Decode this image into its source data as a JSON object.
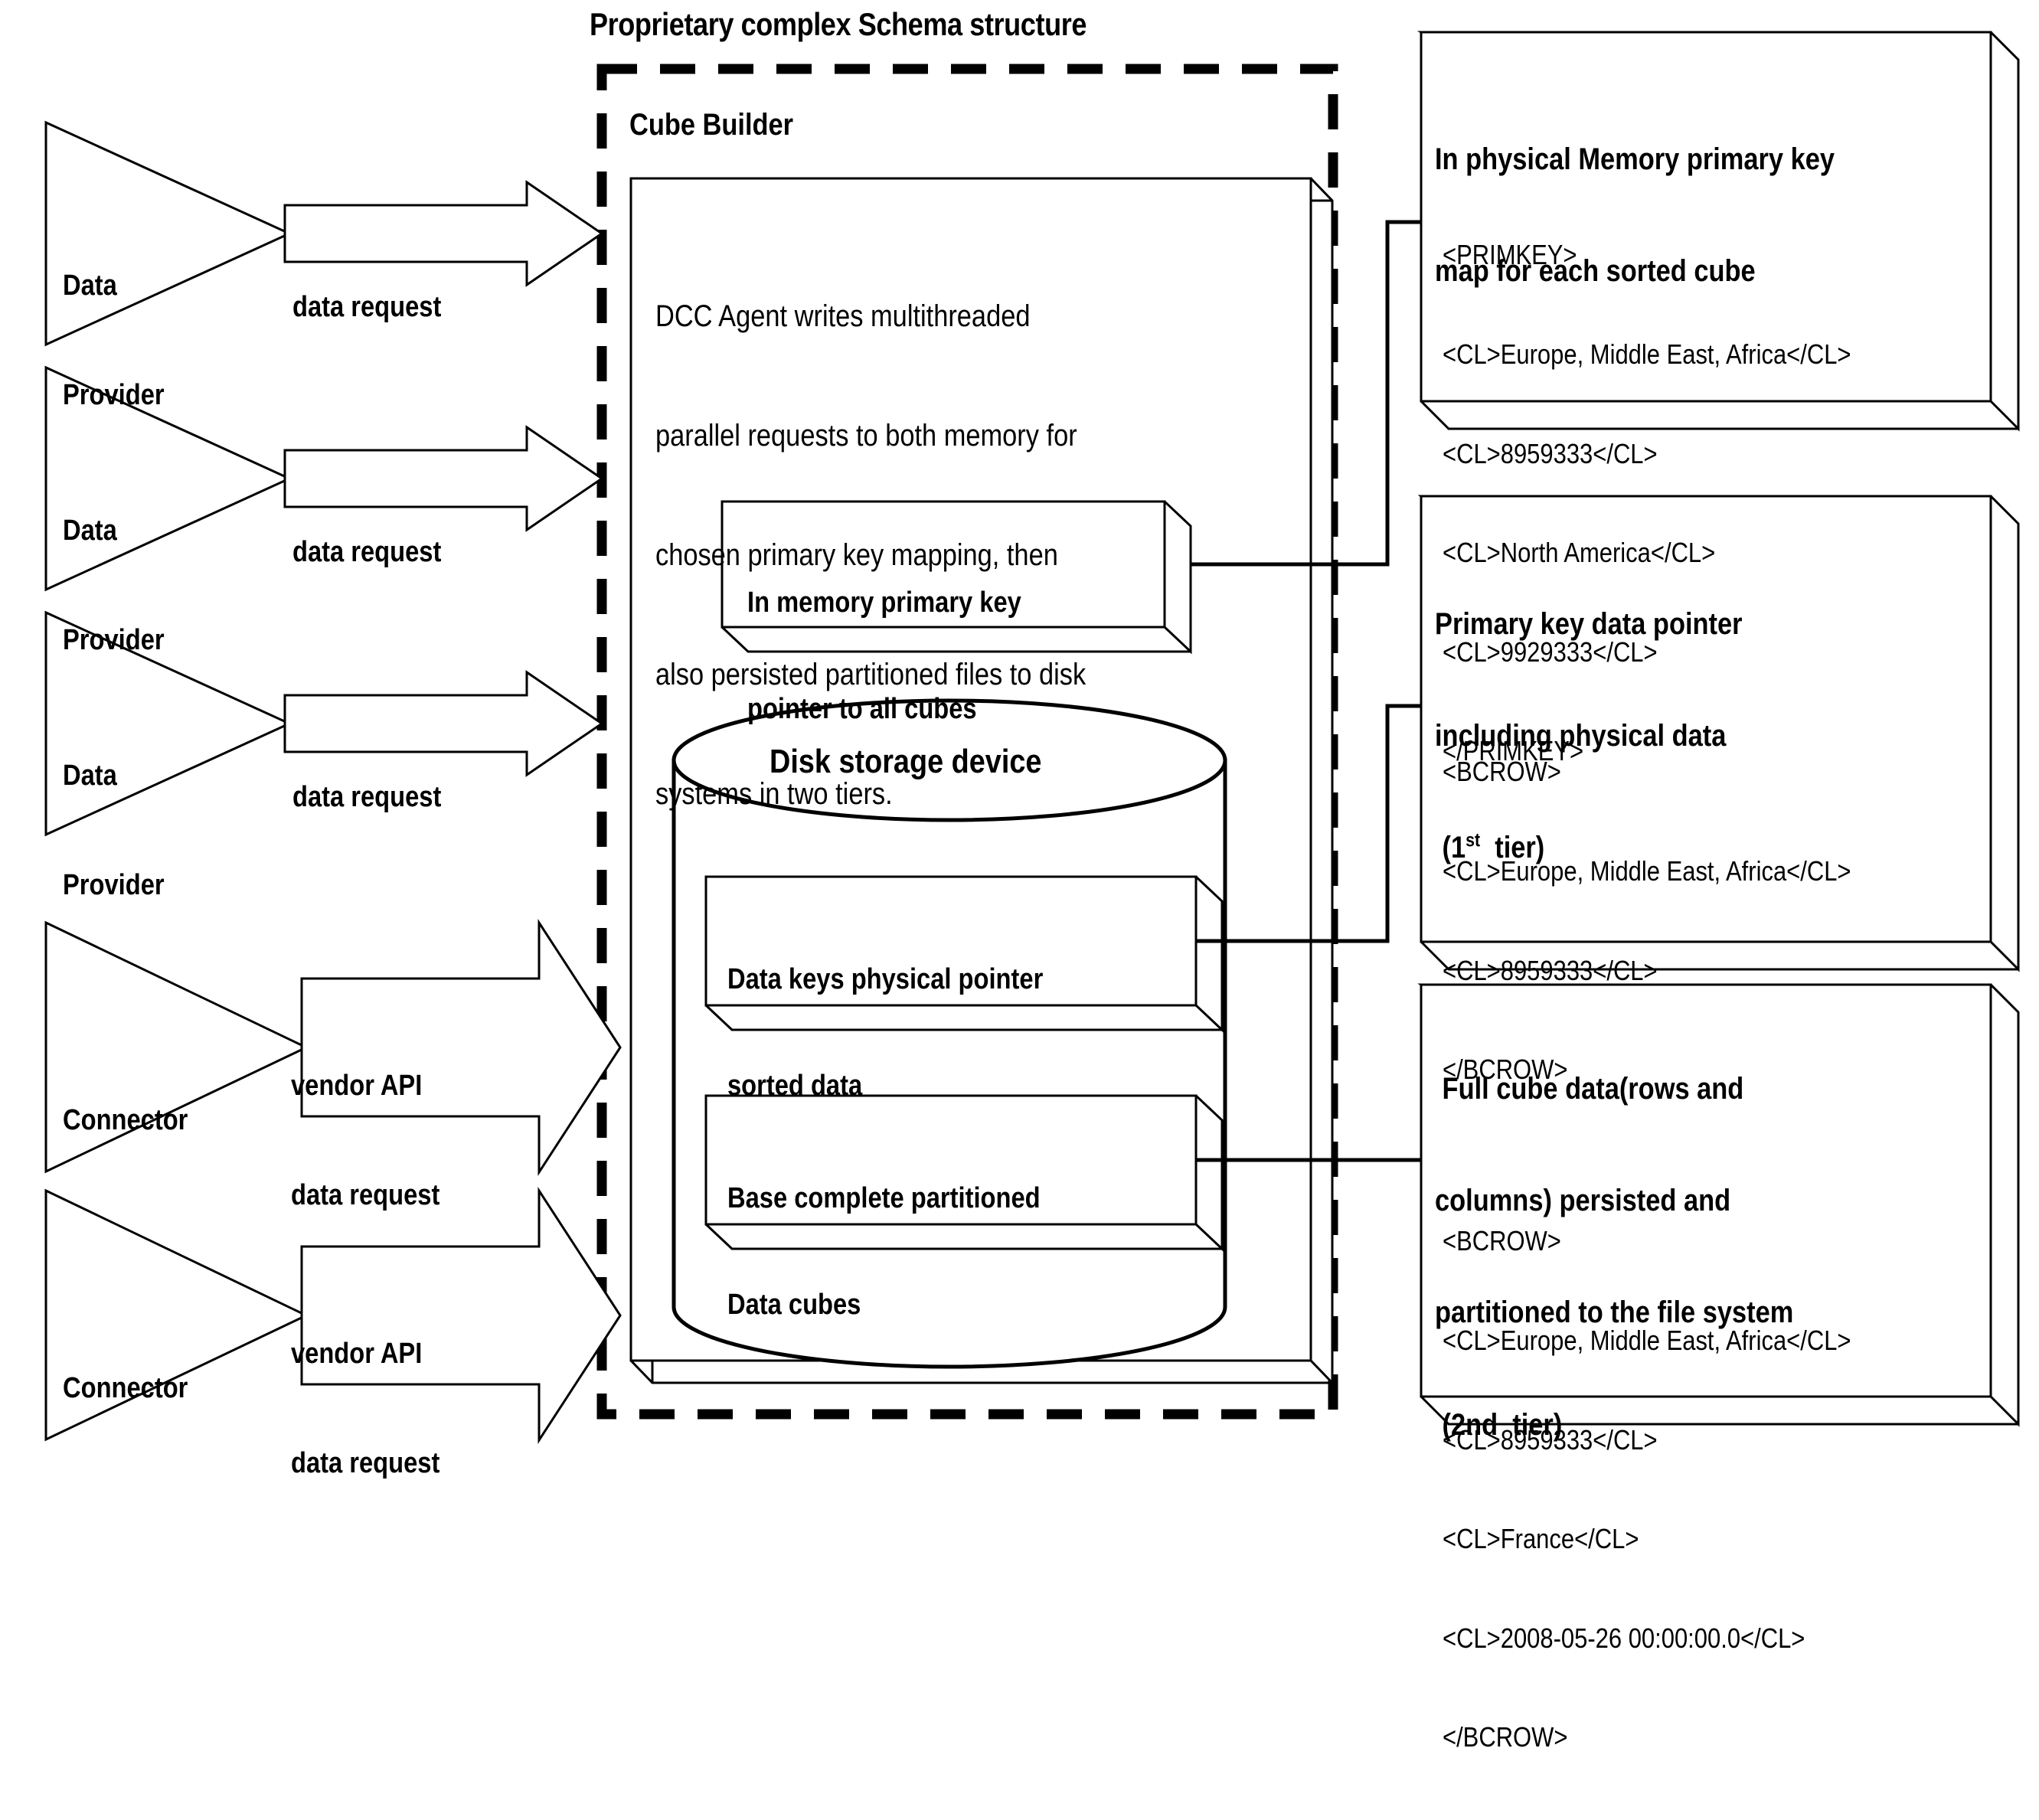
{
  "diagram": {
    "title": "Proprietary complex Schema structure",
    "container_label": "Cube Builder",
    "body_text": "DCC Agent writes multithreaded parallel requests to both memory for chosen primary key mapping, then also persisted partitioned files to disk systems in two tiers.",
    "body_lines": [
      "DCC Agent writes multithreaded",
      "parallel requests to both memory for",
      "chosen primary key mapping, then",
      "also persisted partitioned files to disk",
      "systems in two tiers."
    ],
    "memory_box": {
      "line1": "In memory primary key",
      "line2": "pointer to all cubes"
    },
    "disk": {
      "label": "Disk storage device"
    },
    "disk_box_1": {
      "line1": "Data keys physical pointer",
      "line2": "sorted data"
    },
    "disk_box_2": {
      "line1": "Base complete partitioned",
      "line2": "Data cubes"
    }
  },
  "sources": [
    {
      "name": "Data Provider",
      "lines": [
        "Data",
        "Provider"
      ],
      "arrow_lines": [
        "data request"
      ]
    },
    {
      "name": "Data Provider",
      "lines": [
        "Data",
        "Provider"
      ],
      "arrow_lines": [
        "data request"
      ]
    },
    {
      "name": "Data Provider",
      "lines": [
        "Data",
        "Provider"
      ],
      "arrow_lines": [
        "data request"
      ]
    },
    {
      "name": "Connector",
      "lines": [
        "Connector"
      ],
      "arrow_lines": [
        "vendor API",
        "data request"
      ]
    },
    {
      "name": "Connector",
      "lines": [
        "Connector"
      ],
      "arrow_lines": [
        "vendor API",
        "data request"
      ]
    }
  ],
  "panels": [
    {
      "id": "primkey-map",
      "heading_lines": [
        "In physical Memory primary key",
        "map for each sorted cube"
      ],
      "xml_lines": [
        "<PRIMKEY>",
        "<CL>Europe, Middle East, Africa</CL>",
        "<CL>8959333</CL>",
        "<CL>North America</CL>",
        "<CL>9929333</CL>",
        "</PRIMKEY>"
      ]
    },
    {
      "id": "first-tier",
      "heading_lines": [
        "Primary key data pointer",
        "including physical data"
      ],
      "heading_tier_prefix": " (1",
      "heading_tier_sup": "st",
      "heading_tier_suffix": "  tier)",
      "xml_lines": [
        "<BCROW>",
        "<CL>Europe, Middle East, Africa</CL>",
        "<CL>8959333</CL>",
        "</BCROW>"
      ]
    },
    {
      "id": "second-tier",
      "heading_lines": [
        " Full cube data(rows and",
        "columns) persisted and",
        "partitioned to the file system",
        " (2nd  tier)"
      ],
      "xml_lines": [
        "<BCROW>",
        "<CL>Europe, Middle East, Africa</CL>",
        "<CL>8959333</CL>",
        "<CL>France</CL>",
        "<CL>2008-05-26 00:00:00.0</CL>",
        "</BCROW>"
      ]
    }
  ],
  "colors": {
    "stroke": "#000000",
    "fill": "#ffffff"
  }
}
